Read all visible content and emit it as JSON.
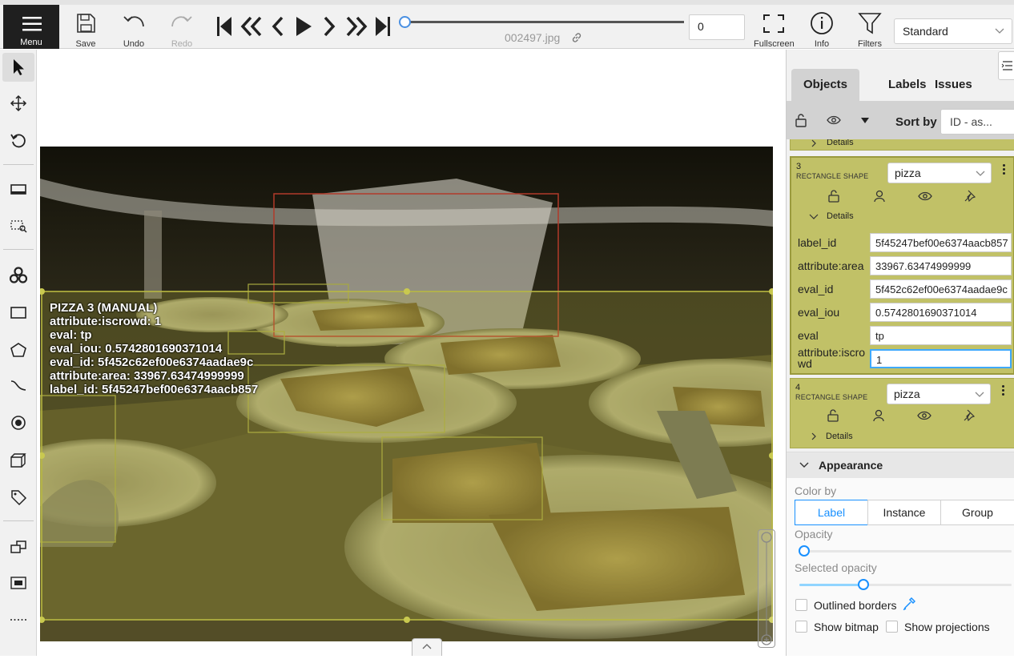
{
  "header": {
    "menu_label": "Menu",
    "save_label": "Save",
    "undo_label": "Undo",
    "redo_label": "Redo",
    "filename": "002497.jpg",
    "frame_number": "0",
    "fullscreen_label": "Fullscreen",
    "info_label": "Info",
    "filters_label": "Filters",
    "workspace": "Standard",
    "player_progress": 0
  },
  "canvas": {
    "overlay_lines": [
      "PIZZA 3 (MANUAL)",
      "attribute:iscrowd: 1",
      "eval: tp",
      "eval_iou: 0.5742801690371014",
      "eval_id: 5f452c62ef00e6374aadae9c",
      "attribute:area: 33967.63474999999",
      "label_id: 5f45247bef00e6374aacb857"
    ]
  },
  "sidebar": {
    "tabs": [
      "Objects",
      "Labels",
      "Issues"
    ],
    "sort_by_label": "Sort by",
    "sort_value": "ID - as...",
    "details_label": "Details",
    "objects": [
      {
        "id": "3",
        "type": "RECTANGLE SHAPE",
        "label": "pizza",
        "attributes": [
          {
            "key": "label_id",
            "value": "5f45247bef00e6374aacb857"
          },
          {
            "key": "attribute:area",
            "value": "33967.63474999999"
          },
          {
            "key": "eval_id",
            "value": "5f452c62ef00e6374aadae9c"
          },
          {
            "key": "eval_iou",
            "value": "0.5742801690371014"
          },
          {
            "key": "eval",
            "value": "tp"
          },
          {
            "key": "attribute:iscrowd",
            "value": "1"
          }
        ]
      },
      {
        "id": "4",
        "type": "RECTANGLE SHAPE",
        "label": "pizza"
      }
    ],
    "appearance": {
      "title": "Appearance",
      "color_by_label": "Color by",
      "color_by_options": [
        "Label",
        "Instance",
        "Group"
      ],
      "color_by_selected": "Label",
      "opacity_label": "Opacity",
      "opacity_value": 0.0,
      "selected_opacity_label": "Selected opacity",
      "selected_opacity_value": 0.3,
      "outlined_borders_label": "Outlined borders",
      "show_bitmap_label": "Show bitmap",
      "show_projections_label": "Show projections"
    }
  },
  "colors": {
    "annotation": "#c1c167",
    "highlight": "#1890ff"
  }
}
